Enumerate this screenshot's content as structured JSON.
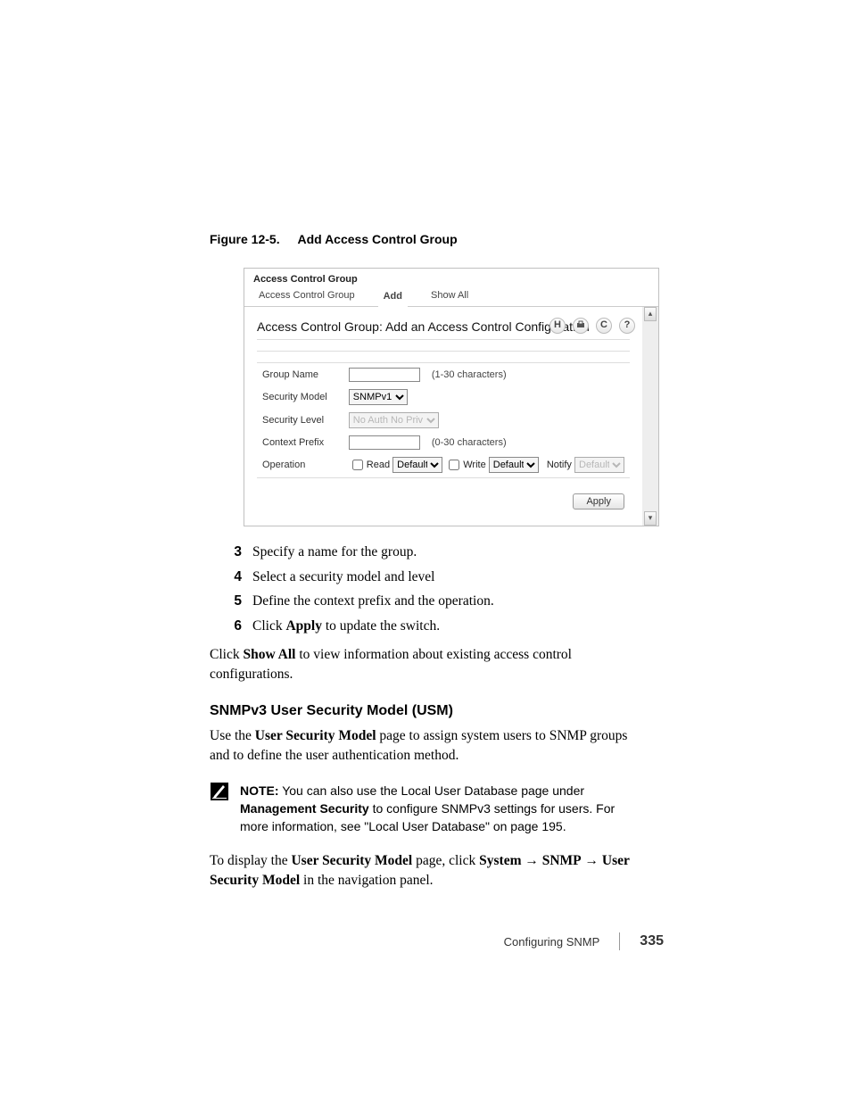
{
  "figure": {
    "id": "Figure 12-5.",
    "title": "Add Access Control Group"
  },
  "screenshot": {
    "window_title": "Access Control Group",
    "tabs": [
      "Access Control Group",
      "Add",
      "Show All"
    ],
    "active_tab_index": 1,
    "page_title": "Access Control Group: Add an Access Control Configuration",
    "toolbar_icons": {
      "save": "H",
      "print": "print-icon",
      "refresh": "C",
      "help": "?"
    },
    "fields": {
      "group_name": {
        "label": "Group Name",
        "value": "",
        "hint": "(1-30 characters)"
      },
      "security_model": {
        "label": "Security Model",
        "selected": "SNMPv1"
      },
      "security_level": {
        "label": "Security Level",
        "selected": "No Auth No Priv"
      },
      "context_prefix": {
        "label": "Context Prefix",
        "value": "",
        "hint": "(0-30 characters)"
      },
      "operation": {
        "label": "Operation",
        "read_label": "Read",
        "read_value": "Default",
        "write_label": "Write",
        "write_value": "Default",
        "notify_label": "Notify",
        "notify_value": "Default"
      }
    },
    "apply_button": "Apply"
  },
  "steps": [
    {
      "n": "3",
      "text": "Specify a name for the group."
    },
    {
      "n": "4",
      "text": "Select a security model and level"
    },
    {
      "n": "5",
      "text": "Define the context prefix and the operation."
    },
    {
      "n": "6",
      "text_pre": "Click ",
      "text_bold": "Apply",
      "text_post": " to update the switch."
    }
  ],
  "para_showall_pre": "Click ",
  "para_showall_bold": "Show All",
  "para_showall_post": " to view information about existing access control configurations.",
  "section_heading": "SNMPv3 User Security Model (USM)",
  "para_usm_pre": "Use the ",
  "para_usm_bold": "User Security Model",
  "para_usm_post": " page to assign system users to SNMP groups and to define the user authentication method.",
  "note": {
    "label": "NOTE:",
    "text_pre": " You can also use the Local User Database page under ",
    "text_bold": "Management Security",
    "text_post": " to configure SNMPv3 settings for users. For more information, see \"Local User Database\" on page 195."
  },
  "para_nav_1": "To display the ",
  "para_nav_b1": "User Security Model",
  "para_nav_2": " page, click ",
  "para_nav_b2": "System",
  "para_nav_arrow": " → ",
  "para_nav_b3": "SNMP",
  "para_nav_b4": "User Security Model",
  "para_nav_3": " in the navigation panel.",
  "footer": {
    "section": "Configuring SNMP",
    "page": "335"
  }
}
